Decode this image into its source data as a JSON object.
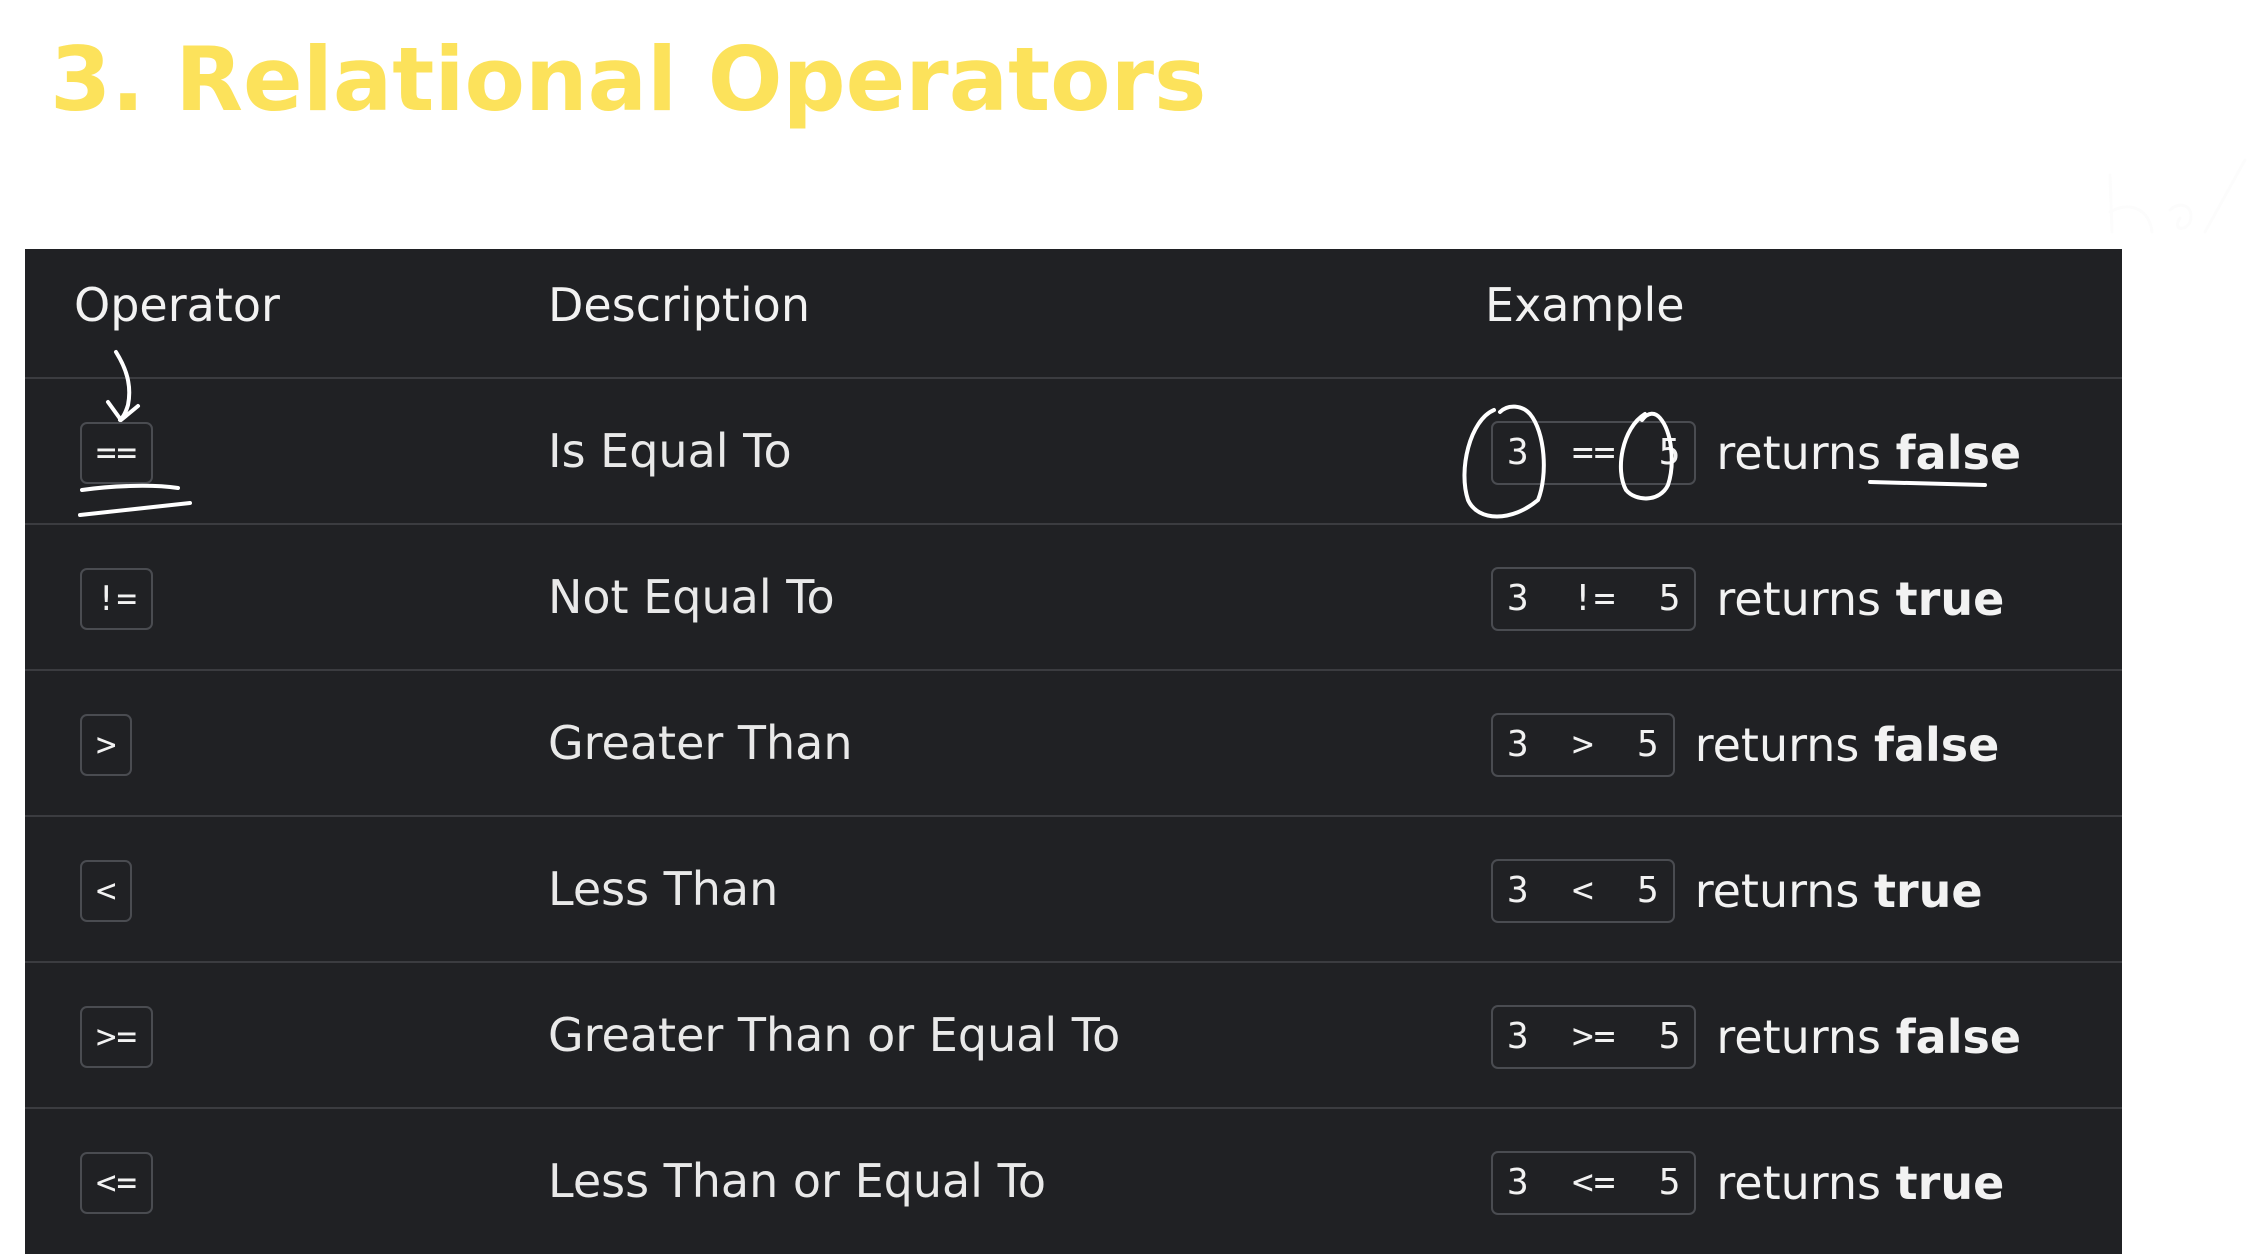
{
  "title": "3. Relational Operators",
  "table": {
    "headers": [
      "Operator",
      "Description",
      "Example"
    ],
    "rows": [
      {
        "op": "==",
        "desc": "Is Equal To",
        "code": "3  ==  5",
        "returns": "returns",
        "result": "false"
      },
      {
        "op": "!=",
        "desc": "Not Equal To",
        "code": "3  !=  5",
        "returns": "returns",
        "result": "true"
      },
      {
        "op": ">",
        "desc": "Greater Than",
        "code": "3  >  5",
        "returns": "returns",
        "result": "false"
      },
      {
        "op": "<",
        "desc": "Less Than",
        "code": "3  <  5",
        "returns": "returns",
        "result": "true"
      },
      {
        "op": ">=",
        "desc": "Greater Than or Equal To",
        "code": "3  >=  5",
        "returns": "returns",
        "result": "false"
      },
      {
        "op": "<=",
        "desc": "Less Than or Equal To",
        "code": "3  <=  5",
        "returns": "returns",
        "result": "true"
      }
    ]
  },
  "colors": {
    "title": "#fce25b",
    "table_bg": "#202124",
    "text": "#f2f2f2",
    "ink": "#ffffff"
  }
}
